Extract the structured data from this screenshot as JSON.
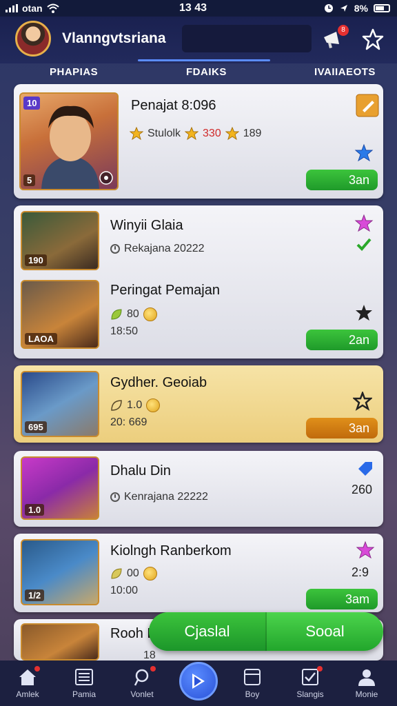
{
  "status_bar": {
    "carrier": "otan",
    "time": "13 43",
    "battery": "8%"
  },
  "header": {
    "title": "Vlanngvtsriana",
    "notification_count": "8"
  },
  "tabs": [
    {
      "label": "PHAPIAS"
    },
    {
      "label": "FDAIKS"
    },
    {
      "label": "IVAIIAEOTS"
    }
  ],
  "cards": [
    {
      "title": "Penajat 8:096",
      "rating_label": "Stulolk",
      "rating_value": "330",
      "rating_value2": "189",
      "thumb_top_badge": "10",
      "thumb_badge": "5",
      "pill": "3an"
    },
    {
      "title": "Winyii Glaia",
      "sub": "Rekajana 20222",
      "thumb_badge": "190"
    },
    {
      "title": "Peringat Pemajan",
      "points": "80",
      "time": "18:50",
      "thumb_badge": "LAOA",
      "pill": "2an"
    },
    {
      "title": "Gydher. Geoiab",
      "points": "1.0",
      "time": "20: 669",
      "thumb_badge": "695",
      "pill": "3an"
    },
    {
      "title": "Dhalu Din",
      "sub": "Kenrajana 22222",
      "side": "260",
      "thumb_badge": "1.0"
    },
    {
      "title": "Kiolngh Ranberkom",
      "points": "00",
      "time": "10:00",
      "side": "2:9",
      "thumb_badge": "1/2",
      "pill": "3am"
    },
    {
      "title": "Rooh D",
      "points": "18"
    }
  ],
  "segmented": {
    "left": "Cjaslal",
    "right": "Sooal"
  },
  "bottom_nav": [
    {
      "label": "Amlek"
    },
    {
      "label": "Pamia"
    },
    {
      "label": "Vonlet"
    },
    {
      "label": ""
    },
    {
      "label": "Boy"
    },
    {
      "label": "Slangis"
    },
    {
      "label": "Monie"
    }
  ],
  "colors": {
    "green": "#22a62c",
    "orange": "#c06a0c",
    "gold_card": "#ecce7d",
    "nav_bg": "#1c2040"
  }
}
